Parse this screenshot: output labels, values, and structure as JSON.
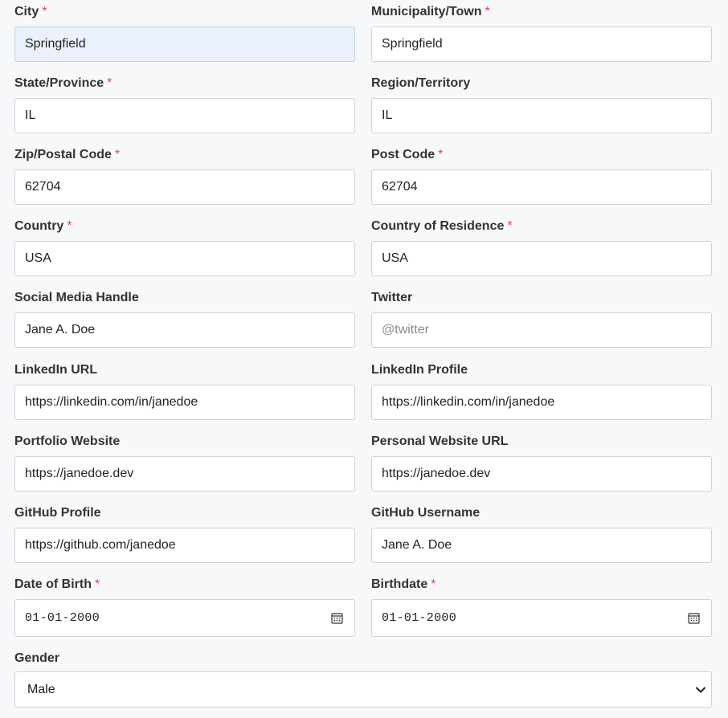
{
  "fields": {
    "city": {
      "label": "City",
      "required": "*",
      "value": "Springfield"
    },
    "municipality": {
      "label": "Municipality/Town",
      "required": "*",
      "value": "Springfield"
    },
    "state": {
      "label": "State/Province",
      "required": "*",
      "value": "IL"
    },
    "region": {
      "label": "Region/Territory",
      "value": "IL"
    },
    "zip": {
      "label": "Zip/Postal Code",
      "required": "*",
      "value": "62704"
    },
    "postcode": {
      "label": "Post Code",
      "required": "*",
      "value": "62704"
    },
    "country": {
      "label": "Country",
      "required": "*",
      "value": "USA"
    },
    "country_residence": {
      "label": "Country of Residence",
      "required": "*",
      "value": "USA"
    },
    "social_handle": {
      "label": "Social Media Handle",
      "value": "Jane A. Doe"
    },
    "twitter": {
      "label": "Twitter",
      "value": "",
      "placeholder": "@twitter"
    },
    "linkedin_url": {
      "label": "LinkedIn URL",
      "value": "https://linkedin.com/in/janedoe"
    },
    "linkedin_profile": {
      "label": "LinkedIn Profile",
      "value": "https://linkedin.com/in/janedoe"
    },
    "portfolio": {
      "label": "Portfolio Website",
      "value": "https://janedoe.dev"
    },
    "personal_site": {
      "label": "Personal Website URL",
      "value": "https://janedoe.dev"
    },
    "github_profile": {
      "label": "GitHub Profile",
      "value": "https://github.com/janedoe"
    },
    "github_username": {
      "label": "GitHub Username",
      "value": "Jane A. Doe"
    },
    "dob": {
      "label": "Date of Birth",
      "required": "*",
      "value": "01-01-2000",
      "icon": "calendar-icon"
    },
    "birthdate": {
      "label": "Birthdate",
      "required": "*",
      "value": "01-01-2000",
      "icon": "calendar-icon"
    },
    "gender": {
      "label": "Gender",
      "value": "Male",
      "icon": "chevron-down-icon"
    }
  },
  "colors": {
    "required": "#e04848",
    "focused_bg": "#eaf0fc",
    "border": "#cfd3d8",
    "page_bg": "#f7f8fa"
  }
}
